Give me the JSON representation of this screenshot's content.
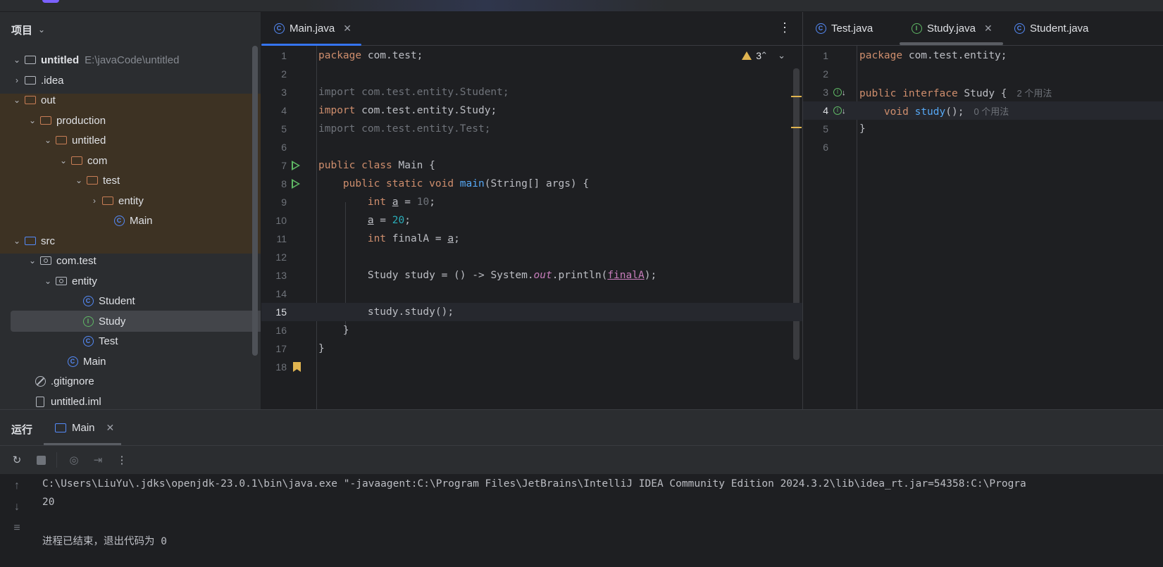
{
  "colors": {
    "accent": "#3574f0",
    "out_highlight": "#3d3223",
    "run_green": "#5fb865",
    "warning_yellow": "#e0b450"
  },
  "project": {
    "title": "项目",
    "tree": [
      {
        "label": "untitled",
        "path": "E:\\javaCode\\untitled",
        "icon": "module-folder-icon"
      },
      {
        "label": ".idea",
        "icon": "folder-icon"
      },
      {
        "label": "out",
        "icon": "folder-icon"
      },
      {
        "label": "production",
        "icon": "folder-icon"
      },
      {
        "label": "untitled",
        "icon": "folder-icon"
      },
      {
        "label": "com",
        "icon": "folder-icon"
      },
      {
        "label": "test",
        "icon": "folder-icon"
      },
      {
        "label": "entity",
        "icon": "folder-icon"
      },
      {
        "label": "Main",
        "icon": "class-run-icon"
      },
      {
        "label": "src",
        "icon": "source-folder-icon"
      },
      {
        "label": "com.test",
        "icon": "package-icon"
      },
      {
        "label": "entity",
        "icon": "package-icon"
      },
      {
        "label": "Student",
        "icon": "class-icon"
      },
      {
        "label": "Study",
        "icon": "interface-icon"
      },
      {
        "label": "Test",
        "icon": "class-icon"
      },
      {
        "label": "Main",
        "icon": "class-run-icon"
      },
      {
        "label": ".gitignore",
        "icon": "gitignore-icon"
      },
      {
        "label": "untitled.iml",
        "icon": "file-icon"
      }
    ]
  },
  "editor_main": {
    "tab_label": "Main.java",
    "warnings_count": "3",
    "line_numbers": [
      "1",
      "2",
      "3",
      "4",
      "5",
      "6",
      "7",
      "8",
      "9",
      "10",
      "11",
      "12",
      "13",
      "14",
      "15",
      "16",
      "17",
      "18"
    ],
    "code": {
      "l1_kw": "package",
      "l1_rest": " com.test;",
      "l3": "import com.test.entity.Student;",
      "l4_kw": "import",
      "l4_rest": " com.test.entity.Study;",
      "l5": "import com.test.entity.Test;",
      "l7_kw": "public class",
      "l7_rest": " Main {",
      "l8_kw": "public static void",
      "l8_fn": "main",
      "l8_rest": "(String[] args) {",
      "l9_kw": "int",
      "l9_var": "a",
      "l9_eq": " = ",
      "l9_num": "10",
      "l9_end": ";",
      "l10_var": "a",
      "l10_eq": " = ",
      "l10_num": "20",
      "l10_end": ";",
      "l11_kw": "int",
      "l11_rest": " finalA = ",
      "l11_var": "a",
      "l11_end": ";",
      "l13_a": "Study study = () -> System.",
      "l13_out": "out",
      "l13_b": ".println(",
      "l13_var": "finalA",
      "l13_end": ");",
      "l15": "study.study();",
      "l16": "}",
      "l17": "}"
    }
  },
  "editor_right": {
    "tabs": [
      "Test.java",
      "Study.java",
      "Student.java"
    ],
    "line_numbers": [
      "1",
      "2",
      "3",
      "4",
      "5",
      "6"
    ],
    "code": {
      "l1_kw": "package",
      "l1_rest": " com.test.entity;",
      "l3_kw": "public interface",
      "l3_rest": " Study {",
      "l3_hint": "2 个用法",
      "l4_kw": "void",
      "l4_fn": "study",
      "l4_rest": "();",
      "l4_hint": "0 个用法",
      "l5": "}"
    }
  },
  "run": {
    "title": "运行",
    "tab_label": "Main",
    "console": [
      "C:\\Users\\LiuYu\\.jdks\\openjdk-23.0.1\\bin\\java.exe \"-javaagent:C:\\Program Files\\JetBrains\\IntelliJ IDEA Community Edition 2024.3.2\\lib\\idea_rt.jar=54358:C:\\Progra",
      "20",
      "",
      "进程已结束，退出代码为 0"
    ]
  }
}
